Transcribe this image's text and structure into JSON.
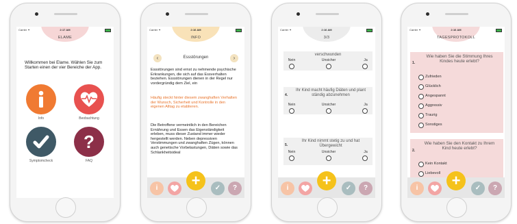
{
  "status": {
    "carrier": "Carrier ✦",
    "times": [
      "2:17 AM",
      "2:16 AM",
      "2:16 AM",
      "2:16 AM"
    ]
  },
  "screen1": {
    "title": "ELAME",
    "welcome": "Willkommen bei Elame. Wählen Sie zum Starten einen der vier Bereiche der App.",
    "tiles": {
      "info": "Info",
      "observation": "Beobachtung",
      "symptom": "Symptomcheck",
      "faq": "FAQ"
    },
    "tile_glyphs": {
      "info": "i",
      "faq": "?",
      "check": "✓"
    }
  },
  "screen2": {
    "title": "INFO",
    "section": "Essstörungen",
    "para1": "Essstörungen sind ernst zu nehmende psychische Erkrankungen, die sich auf das Essverhalten beziehen. Essstörungen dienen in der Regel nur vordergründig dem Ziel, ein",
    "para2": "Häufig steckt hinter diesem zwanghaften Verhalten der Wunsch, Sicherheit und Kontrolle in den eigenen Alltag zu etablieren.",
    "para3": "Die Betroffene vermeintlich in den Bereichen Ernährung und Essen das Eigenständigkeit erleben, muss dieser Zustand immer wieder hergestellt werden. Neben depressiven Verstimmungen und zwanghaften Zügen, können auch genetische Vorbelastungen, Diäten sowie das Schlankheitsideal"
  },
  "screen3": {
    "title": "3/3",
    "labels": {
      "no": "Nein",
      "unsure": "Unsicher",
      "yes": "Ja"
    },
    "q_top": "verschwunden",
    "q4_num": "4.",
    "q4": "Ihr Kind macht häufig Diäten und plant ständig abzunehmen",
    "q5_num": "5.",
    "q5": "Ihr Kind nimmt stetig zu und hat Übergewicht"
  },
  "screen4": {
    "title": "TAGESPROTOKOLL",
    "q1_num": "1.",
    "q1": "Wie haben Sie die Stimmung Ihres Kindes heute erlebt?",
    "q1_options": [
      "Zufrieden",
      "Glücklich",
      "Angespannt",
      "Aggressiv",
      "Traurig",
      "Sonstiges"
    ],
    "q2_num": "2.",
    "q2": "Wie haben Sie den Kontakt zu Ihrem Kind heute erlebt?",
    "q2_options": [
      "Kein Kontakt",
      "Liebevoll"
    ]
  },
  "nav": {
    "info": "i",
    "add": "+",
    "check": "✓",
    "faq": "?"
  },
  "colors": {
    "info": "#f07a32",
    "observation": "#e8514f",
    "symptom": "#3f5966",
    "faq": "#8c2f48",
    "add": "#f5c21b",
    "header1": "#f6d6d6",
    "header2": "#f9e2b8",
    "header3": "#ececec",
    "header4": "#f5dada",
    "warning_text": "#e8732a"
  }
}
